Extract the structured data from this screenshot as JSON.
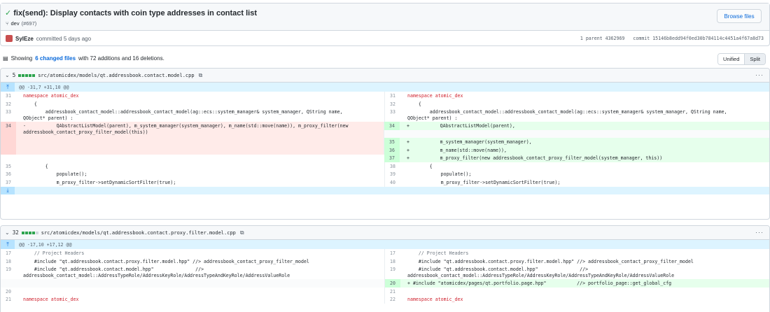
{
  "commit": {
    "title": "fix(send): Display contacts with coin type addresses in contact list",
    "branch": "dev",
    "pr": "(#697)",
    "browse_label": "Browse files",
    "author": "SylEze",
    "committed_text": "committed 5 days ago",
    "parent_text": "1 parent 4362969",
    "commit_text": "commit 15146b8edd94f0ed30b784114c4451a4f67a8d73"
  },
  "summary": {
    "prefix": "Showing",
    "changed": "6 changed files",
    "middle": "with 72 additions and 16 deletions."
  },
  "view": {
    "unified": "Unified",
    "split": "Split",
    "selected": "Split"
  },
  "files": [
    {
      "count": "5",
      "path": "src/atomicdex/models/qt.addressbook.contact.model.cpp",
      "hunk": "@@ -31,7 +31,10 @@",
      "left": [
        {
          "n": "31",
          "t": "    namespace atomic_dex"
        },
        {
          "n": "32",
          "t": "    {"
        },
        {
          "n": "33",
          "t": "        addressbook_contact_model::addressbook_contact_model(ag::ecs::system_manager& system_manager, QString name,\nQObject* parent) :"
        },
        {
          "n": "34",
          "t": "-           QAbstractListModel(parent), m_system_manager(system_manager), m_name(std::move(name)), m_proxy_filter(new\naddressbook_contact_proxy_filter_model(this))"
        },
        {
          "n": "35",
          "t": "        {"
        },
        {
          "n": "36",
          "t": "            populate();"
        },
        {
          "n": "37",
          "t": "            m_proxy_filter->setDynamicSortFilter(true);"
        }
      ],
      "right": [
        {
          "n": "31",
          "t": "    namespace atomic_dex"
        },
        {
          "n": "32",
          "t": "    {"
        },
        {
          "n": "33",
          "t": "        addressbook_contact_model::addressbook_contact_model(ag::ecs::system_manager& system_manager, QString name,\nQObject* parent) :"
        },
        {
          "n": "34",
          "t": "+           QAbstractListModel(parent),"
        },
        {
          "n": "35",
          "t": "+           m_system_manager(system_manager),"
        },
        {
          "n": "36",
          "t": "+           m_name(std::move(name)),"
        },
        {
          "n": "37",
          "t": "+           m_proxy_filter(new addressbook_contact_proxy_filter_model(system_manager, this))"
        },
        {
          "n": "38",
          "t": "        {"
        },
        {
          "n": "39",
          "t": "            populate();"
        },
        {
          "n": "40",
          "t": "            m_proxy_filter->setDynamicSortFilter(true);"
        }
      ]
    },
    {
      "count": "32",
      "path": "src/atomicdex/models/qt.addressbook.contact.proxy.filter.model.cpp",
      "hunk": "@@ -17,10 +17,12 @@",
      "left": [
        {
          "n": "17",
          "t": "    // Project Headers"
        },
        {
          "n": "18",
          "t": "    #include \"qt.addressbook.contact.proxy.filter.model.hpp\" //> addressbook_contact_proxy_filter_model"
        },
        {
          "n": "19",
          "t": "    #include \"qt.addressbook.contact.model.hpp\"               //>\naddressbook_contact_model::AddressTypeRole/AddressKeyRole/AddressTypeAndKeyRole/AddressValueRole"
        },
        {
          "n": "20",
          "t": ""
        },
        {
          "n": "21",
          "t": "    namespace atomic_dex"
        }
      ],
      "right": [
        {
          "n": "17",
          "t": "    // Project Headers"
        },
        {
          "n": "18",
          "t": "    #include \"qt.addressbook.contact.proxy.filter.model.hpp\" //> addressbook_contact_proxy_filter_model"
        },
        {
          "n": "19",
          "t": "    #include \"qt.addressbook.contact.model.hpp\"               //>\naddressbook_contact_model::AddressTypeRole/AddressKeyRole/AddressTypeAndKeyRole/AddressValueRole"
        },
        {
          "n": "20",
          "t": "+ #include \"atomicdex/pages/qt.portfolio.page.hpp\"           //> portfolio_page::get_global_cfg"
        },
        {
          "n": "21",
          "t": ""
        },
        {
          "n": "22",
          "t": "    namespace atomic_dex"
        }
      ]
    }
  ],
  "icons": {
    "check": "check-icon",
    "branch": "git-branch-icon",
    "file_diff": "file-diff-icon",
    "chevron": "chevron-down-icon",
    "clipboard": "copy-icon",
    "kebab": "kebab-horizontal-icon",
    "expand": "unfold-icon"
  },
  "colors": {
    "added_bg": "#e6ffec",
    "deleted_bg": "#ffebe9",
    "hunk_bg": "#ddf4ff",
    "link": "#0969da"
  }
}
